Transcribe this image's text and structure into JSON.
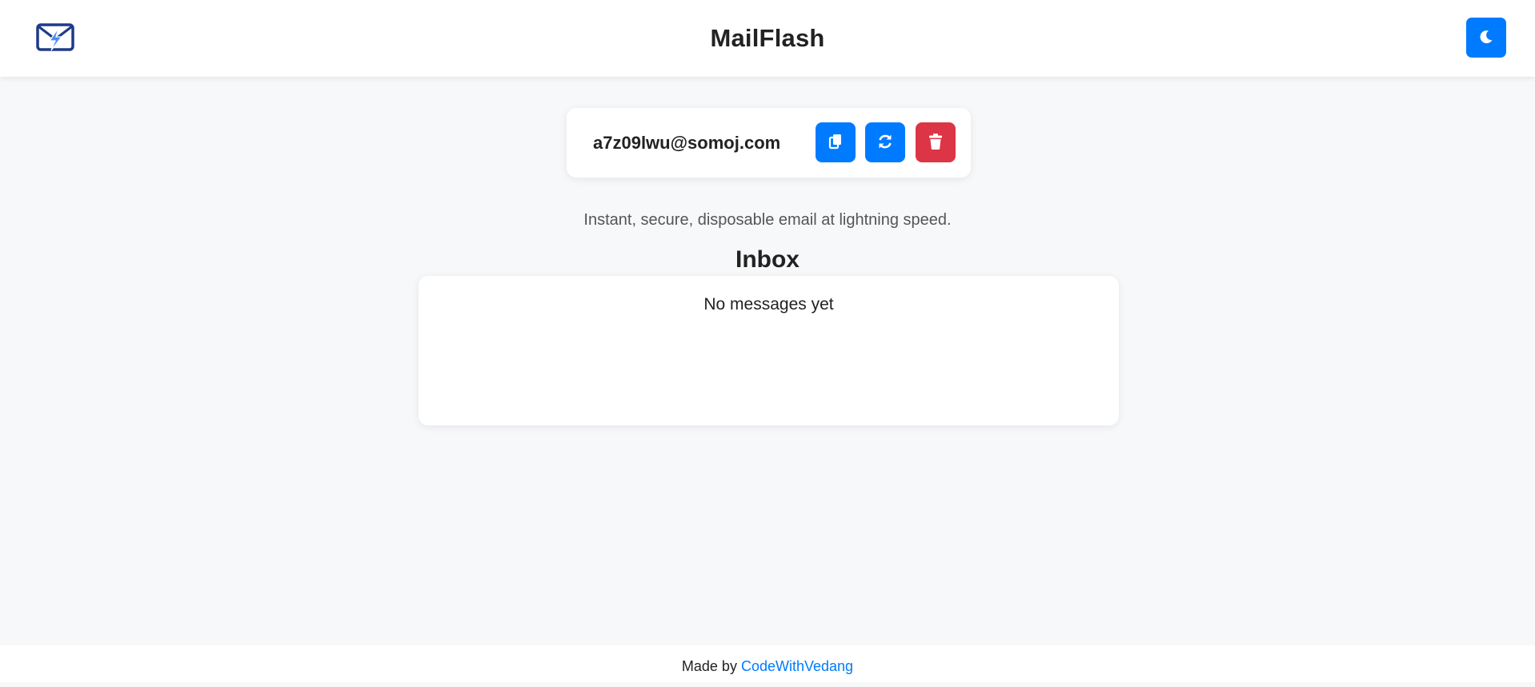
{
  "header": {
    "title": "MailFlash",
    "logo_icon": "envelope-lightning-icon",
    "theme_toggle_icon": "moon-icon"
  },
  "email_box": {
    "address": "a7z09lwu@somoj.com",
    "copy_icon": "copy-icon",
    "refresh_icon": "refresh-icon",
    "delete_icon": "trash-icon"
  },
  "tagline": "Instant, secure, disposable email at lightning speed.",
  "inbox": {
    "title": "Inbox",
    "empty_message": "No messages yet"
  },
  "footer": {
    "prefix": "Made by",
    "author": "CodeWithVedang"
  },
  "colors": {
    "primary": "#007bff",
    "danger": "#dc3545",
    "background": "#f7f8fa",
    "logo": "#1e3a8a"
  }
}
